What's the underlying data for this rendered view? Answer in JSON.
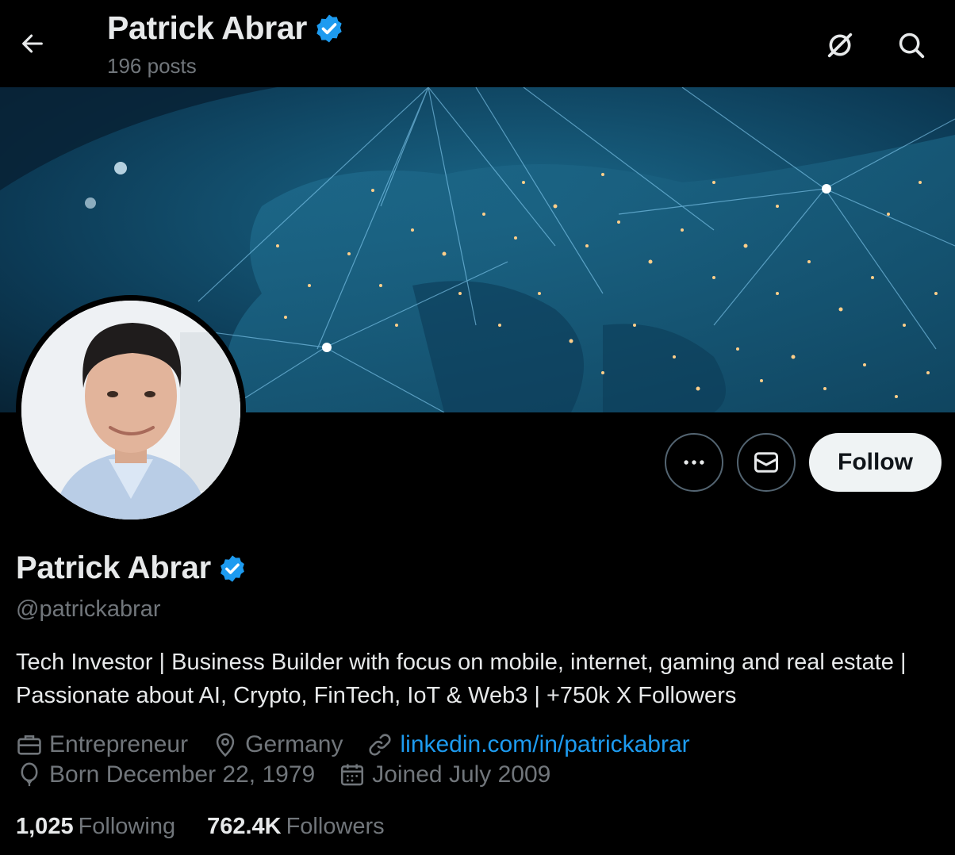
{
  "header": {
    "title": "Patrick Abrar",
    "posts": "196 posts",
    "back_icon": "arrow-left-icon",
    "grok_icon": "grok-icon",
    "search_icon": "search-icon"
  },
  "profile": {
    "name": "Patrick Abrar",
    "handle": "@patrickabrar",
    "verified_color": "#1d9bf0",
    "bio": "Tech Investor | Business Builder with focus on mobile, internet, gaming and real estate | Passionate about AI, Crypto, FinTech, IoT & Web3 | +750k X Followers",
    "profession": "Entrepreneur",
    "location": "Germany",
    "website": "linkedin.com/in/patrickabrar",
    "birthday": "Born December 22, 1979",
    "joined": "Joined July 2009"
  },
  "actions": {
    "more_icon": "more-icon",
    "message_icon": "mail-icon",
    "follow_label": "Follow"
  },
  "stats": {
    "following_count": "1,025",
    "following_label": "Following",
    "followers_count": "762.4K",
    "followers_label": "Followers"
  },
  "colors": {
    "background": "#000000",
    "text_primary": "#e7e9ea",
    "text_secondary": "#71767b",
    "accent": "#1d9bf0",
    "follow_bg": "#eff3f4"
  }
}
